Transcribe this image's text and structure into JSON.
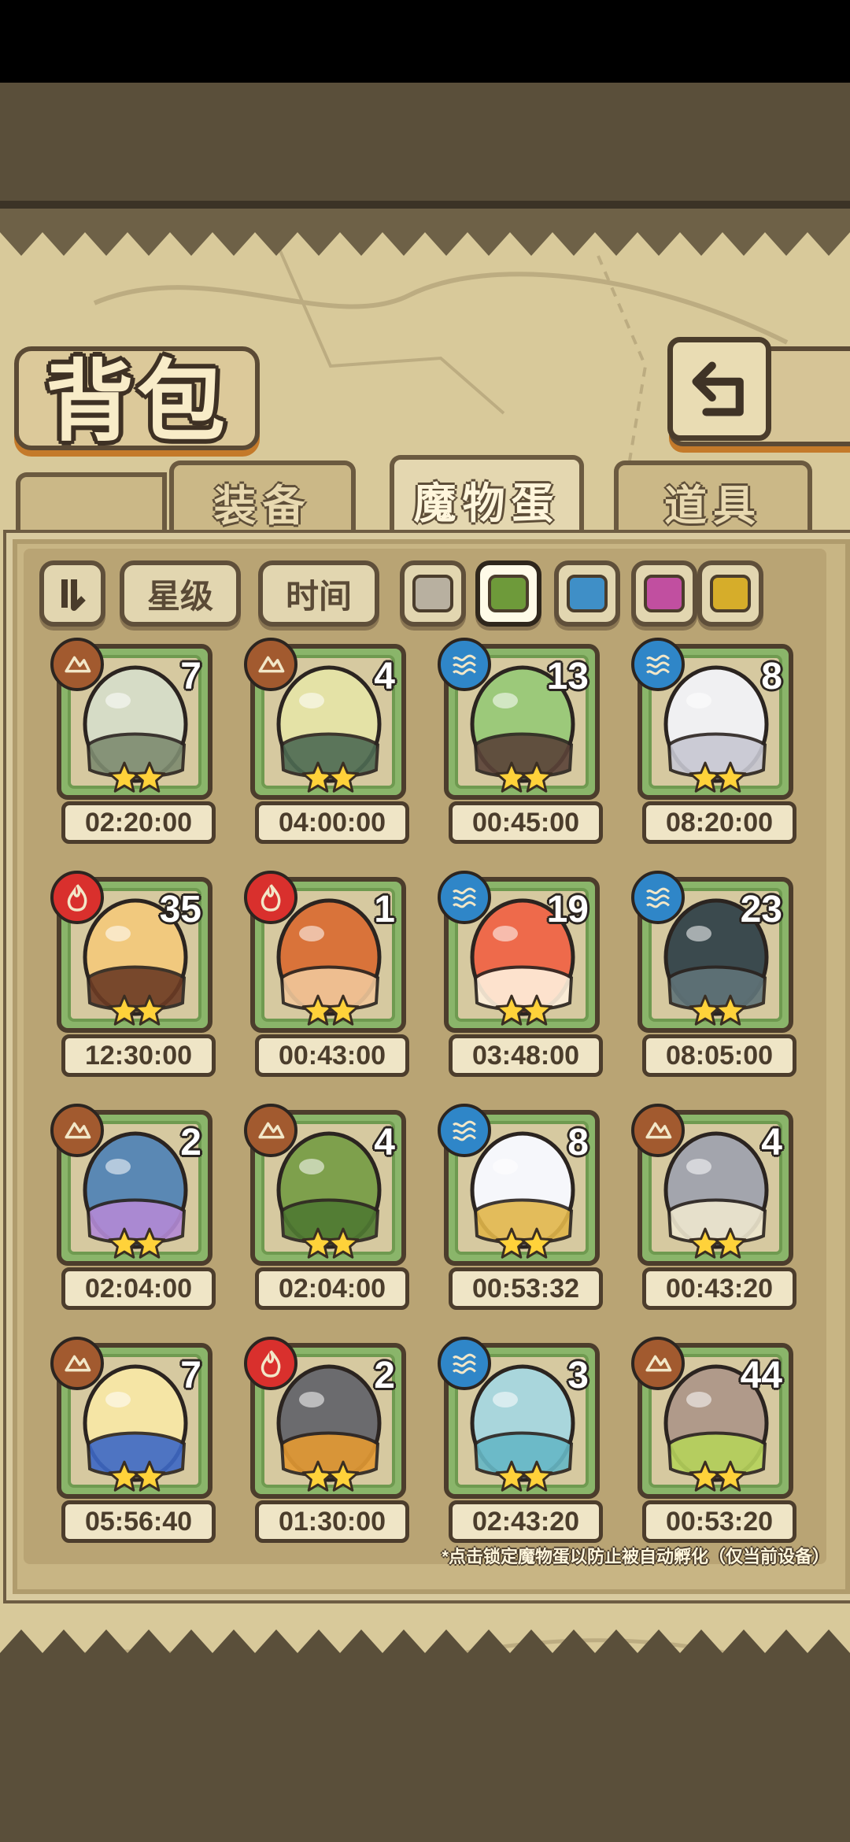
{
  "header": {
    "title": "背包"
  },
  "tabs": [
    {
      "label": "装备",
      "active": false
    },
    {
      "label": "魔物蛋",
      "active": true
    },
    {
      "label": "道具",
      "active": false
    }
  ],
  "filters": {
    "sort_star": "星级",
    "sort_time": "时间",
    "colors": [
      "#b8b0a0",
      "#6e9a3a",
      "#3f8fc7",
      "#c14fa0",
      "#d6ad2a"
    ],
    "selected_color_index": 1
  },
  "elements": {
    "earth": "#a25a2f",
    "fire": "#d9302d",
    "water": "#2f86c8"
  },
  "eggs": [
    {
      "count": "7",
      "time": "02:20:00",
      "element": "earth",
      "base": "#d6dcc6",
      "accent": "#7e8c70"
    },
    {
      "count": "4",
      "time": "04:00:00",
      "element": "earth",
      "base": "#e4e2a6",
      "accent": "#4d6a52"
    },
    {
      "count": "13",
      "time": "00:45:00",
      "element": "water",
      "base": "#9cc97a",
      "accent": "#5a4238"
    },
    {
      "count": "8",
      "time": "08:20:00",
      "element": "water",
      "base": "#f0f0f2",
      "accent": "#c7c7d2"
    },
    {
      "count": "35",
      "time": "12:30:00",
      "element": "fire",
      "base": "#f1c97e",
      "accent": "#6b3b24"
    },
    {
      "count": "1",
      "time": "00:43:00",
      "element": "fire",
      "base": "#d9733a",
      "accent": "#f1c79a"
    },
    {
      "count": "19",
      "time": "03:48:00",
      "element": "water",
      "base": "#ee6a4b",
      "accent": "#fff0dc"
    },
    {
      "count": "23",
      "time": "08:05:00",
      "element": "water",
      "base": "#3b4a4e",
      "accent": "#607479"
    },
    {
      "count": "2",
      "time": "02:04:00",
      "element": "earth",
      "base": "#5a88b4",
      "accent": "#b38ad6"
    },
    {
      "count": "4",
      "time": "02:04:00",
      "element": "earth",
      "base": "#7ea04c",
      "accent": "#4f7a32"
    },
    {
      "count": "8",
      "time": "00:53:32",
      "element": "water",
      "base": "#f6f7fb",
      "accent": "#e1b64a"
    },
    {
      "count": "4",
      "time": "00:43:20",
      "element": "earth",
      "base": "#a3a5ad",
      "accent": "#eee7cf"
    },
    {
      "count": "7",
      "time": "05:56:40",
      "element": "earth",
      "base": "#f5e5a5",
      "accent": "#3d68c6"
    },
    {
      "count": "2",
      "time": "01:30:00",
      "element": "fire",
      "base": "#6b6b6e",
      "accent": "#e49a33"
    },
    {
      "count": "3",
      "time": "02:43:20",
      "element": "water",
      "base": "#a9d6dc",
      "accent": "#66b8c6"
    },
    {
      "count": "44",
      "time": "00:53:20",
      "element": "earth",
      "base": "#b09a8a",
      "accent": "#b6d35b"
    }
  ],
  "footer_note": "*点击锁定魔物蛋以防止被自动孵化（仅当前设备）"
}
